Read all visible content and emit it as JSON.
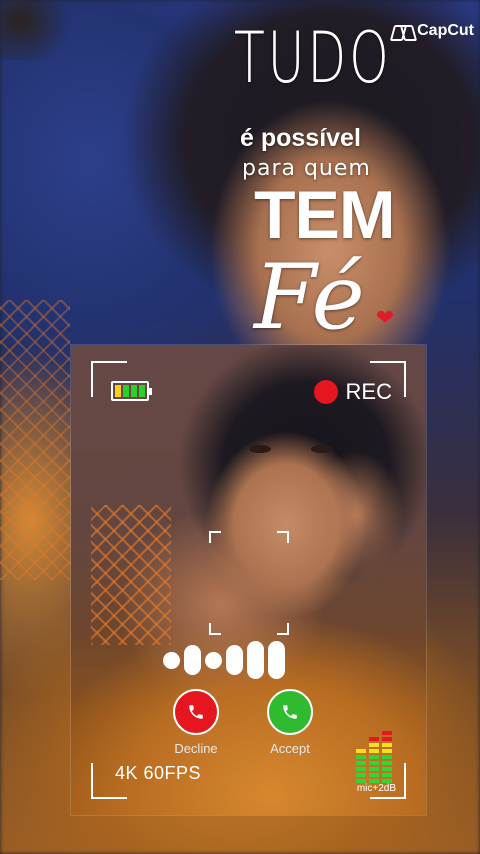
{
  "watermark": {
    "brand": "CapCut",
    "icon": "capcut-logo-icon"
  },
  "overlay_text": {
    "line1": "TUDO",
    "line2": "é possível",
    "line3": "para quem",
    "line4": "TEM",
    "line5": "Fé",
    "heart": "❤"
  },
  "camera": {
    "battery_icon": "battery-icon",
    "battery_level": 1.0,
    "rec_label": "REC",
    "rec_color": "#e5161f",
    "resolution": "4K  60FPS",
    "mic_label": "mic+2dB"
  },
  "call": {
    "decline_label": "Decline",
    "accept_label": "Accept",
    "decline_color": "#e5161f",
    "accept_color": "#2fba2f"
  }
}
